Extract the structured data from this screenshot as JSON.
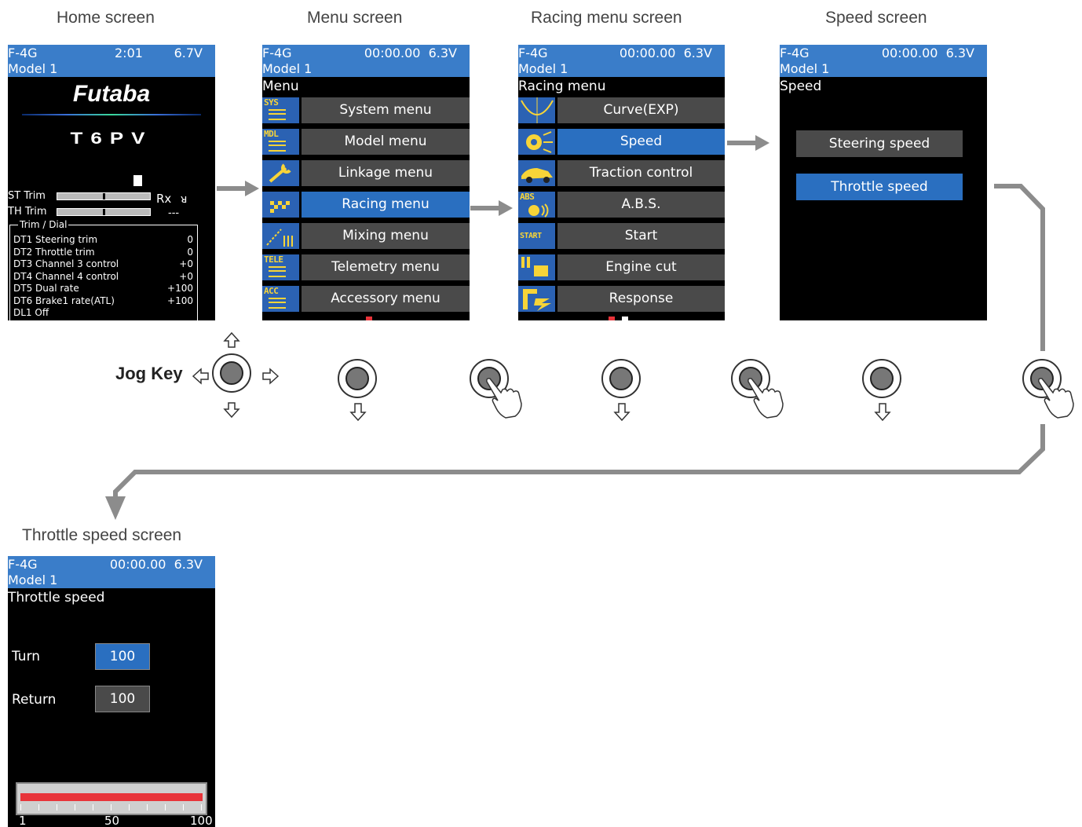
{
  "captions": {
    "home": "Home screen",
    "menu": "Menu screen",
    "racing": "Racing menu screen",
    "speed": "Speed screen",
    "throttle": "Throttle speed screen"
  },
  "jog_key_label": "Jog Key",
  "home": {
    "model_code": "F-4G",
    "time": "2:01",
    "voltage": "6.7V",
    "model_name": "Model 1",
    "logo": "Futaba",
    "product": "T6PV",
    "st_trim_label": "ST Trim",
    "th_trim_label": "TH Trim",
    "rx_label": "Rx",
    "rx_value": "---",
    "trim_dial_label": "Trim / Dial",
    "dt_rows": [
      {
        "name": "DT1 Steering trim",
        "value": "0"
      },
      {
        "name": "DT2 Throttle trim",
        "value": "0"
      },
      {
        "name": "DT3 Channel 3 control",
        "value": "+0"
      },
      {
        "name": "DT4 Channel 4 control",
        "value": "+0"
      },
      {
        "name": "DT5 Dual rate",
        "value": "+100"
      },
      {
        "name": "DT6 Brake1 rate(ATL)",
        "value": "+100"
      },
      {
        "name": "DL1 Off",
        "value": ""
      }
    ]
  },
  "menu": {
    "model_code": "F-4G",
    "timer": "00:00.00",
    "voltage": "6.3V",
    "model_name": "Model 1",
    "title": "Menu",
    "items": [
      {
        "icon_text": "SYS",
        "label": "System menu"
      },
      {
        "icon_text": "MDL",
        "label": "Model menu"
      },
      {
        "icon_text": "",
        "label": "Linkage menu"
      },
      {
        "icon_text": "",
        "label": "Racing menu"
      },
      {
        "icon_text": "",
        "label": "Mixing menu"
      },
      {
        "icon_text": "TELE",
        "label": "Telemetry menu"
      },
      {
        "icon_text": "ACC",
        "label": "Accessory menu"
      }
    ],
    "selected_index": 3
  },
  "racing": {
    "model_code": "F-4G",
    "timer": "00:00.00",
    "voltage": "6.3V",
    "model_name": "Model 1",
    "title": "Racing menu",
    "items": [
      {
        "icon_text": "",
        "label": "Curve(EXP)"
      },
      {
        "icon_text": "",
        "label": "Speed"
      },
      {
        "icon_text": "",
        "label": "Traction control"
      },
      {
        "icon_text": "ABS",
        "label": "A.B.S."
      },
      {
        "icon_text": "START",
        "label": "Start"
      },
      {
        "icon_text": "",
        "label": "Engine cut"
      },
      {
        "icon_text": "",
        "label": "Response"
      }
    ],
    "selected_index": 1
  },
  "speed": {
    "model_code": "F-4G",
    "timer": "00:00.00",
    "voltage": "6.3V",
    "model_name": "Model 1",
    "title": "Speed",
    "steering_label": "Steering speed",
    "throttle_label": "Throttle speed"
  },
  "throttle": {
    "model_code": "F-4G",
    "timer": "00:00.00",
    "voltage": "6.3V",
    "model_name": "Model 1",
    "title": "Throttle speed",
    "turn_label": "Turn",
    "turn_value": "100",
    "return_label": "Return",
    "return_value": "100",
    "bar_min": "1",
    "bar_mid": "50",
    "bar_max": "100",
    "bar_level": 1.0
  },
  "colors": {
    "bar_blue": "#3a7dc9",
    "selected_blue": "#2a6fc0",
    "item_gray": "#4a4a4a",
    "icon_yellow": "#f7d438",
    "flow_arrow": "#8c8c8c",
    "progress_red": "#e8343a"
  }
}
